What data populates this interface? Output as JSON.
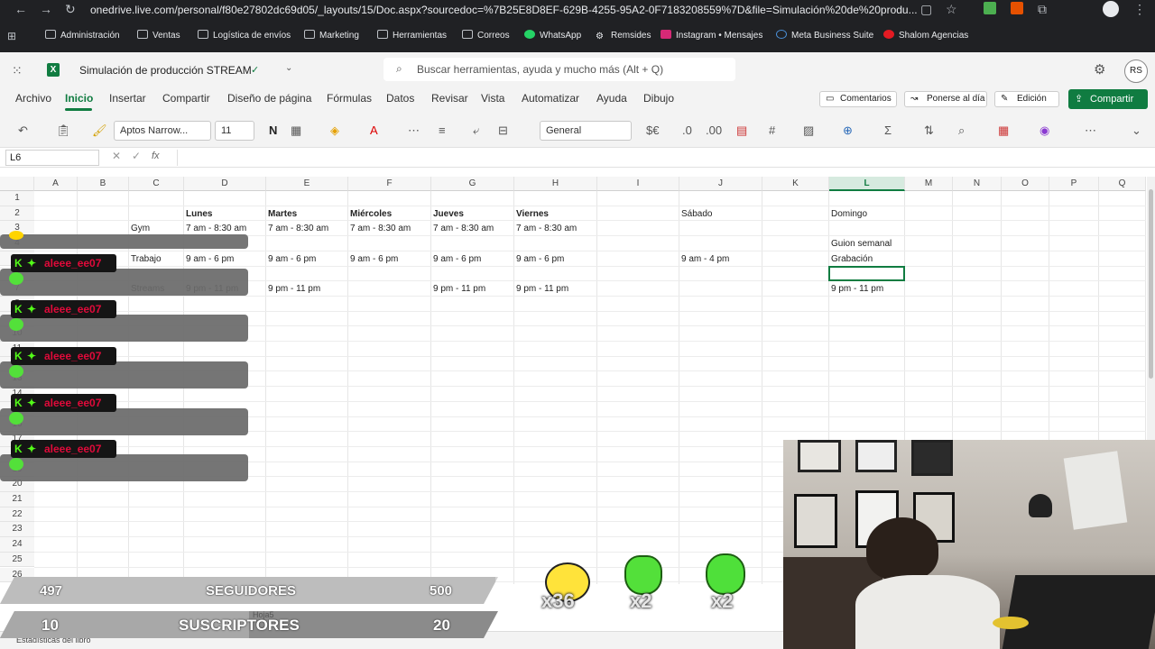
{
  "browser": {
    "url": "onedrive.live.com/personal/f80e27802dc69d05/_layouts/15/Doc.aspx?sourcedoc=%7B25E8D8EF-629B-4255-95A2-0F7183208559%7D&file=Simulación%20de%20produ...",
    "bookmarks": [
      "Administración",
      "Ventas",
      "Logística de envíos",
      "Marketing",
      "Herramientas",
      "Correos",
      "WhatsApp",
      "Remsides",
      "Instagram • Mensajes",
      "Meta Business Suite",
      "Shalom Agencias"
    ]
  },
  "app": {
    "title": "Simulación de producción STREAM",
    "search_placeholder": "Buscar herramientas, ayuda y mucho más (Alt + Q)",
    "avatar": "RS",
    "brand_color": "#107c41"
  },
  "menu": {
    "items": [
      "Archivo",
      "Inicio",
      "Insertar",
      "Compartir",
      "Diseño de página",
      "Fórmulas",
      "Datos",
      "Revisar",
      "Vista",
      "Automatizar",
      "Ayuda",
      "Dibujo"
    ],
    "active": "Inicio",
    "comments": "Comentarios",
    "catchup": "Ponerse al día",
    "editing": "Edición",
    "share": "Compartir"
  },
  "ribbon": {
    "font": "Aptos Narrow...",
    "size": "11",
    "bold": "N",
    "format": "General",
    "currency": "$€"
  },
  "formula": {
    "cell_ref": "L6",
    "fx": "fx"
  },
  "grid": {
    "columns": [
      "A",
      "B",
      "C",
      "D",
      "E",
      "F",
      "G",
      "H",
      "I",
      "J",
      "K",
      "L",
      "M",
      "N",
      "O",
      "P",
      "Q"
    ],
    "selected_col": "L",
    "rows": [
      "1",
      "2",
      "3",
      "4",
      "5",
      "6",
      "7",
      "8",
      "9",
      "10",
      "11",
      "12",
      "13",
      "14",
      "15",
      "16",
      "17",
      "18",
      "19",
      "20",
      "21",
      "22",
      "23",
      "24",
      "25",
      "26"
    ],
    "cells": {
      "D2": "Lunes",
      "E2": "Martes",
      "F2": "Miércoles",
      "G2": "Jueves",
      "H2": "Viernes",
      "J2": "Sábado",
      "L2": "Domingo",
      "C3": "Gym",
      "D3": "7 am - 8:30 am",
      "E3": "7 am - 8:30 am",
      "F3": "7 am - 8:30 am",
      "G3": "7 am - 8:30 am",
      "H3": "7 am - 8:30 am",
      "L4": "Guion semanal",
      "C5": "Trabajo",
      "D5": "9 am - 6 pm",
      "E5": "9 am - 6 pm",
      "F5": "9 am - 6 pm",
      "G5": "9 am - 6 pm",
      "H5": "9 am - 6 pm",
      "J5": "9 am - 4 pm",
      "L5": "Grabación",
      "C7": "Streams",
      "D7": "9 pm - 11 pm",
      "E7": "9 pm - 11 pm",
      "G7": "9 pm - 11 pm",
      "H7": "9 pm - 11 pm",
      "L7": "9 pm - 11 pm"
    }
  },
  "status": {
    "sheet": "Hoja5",
    "stats": "Estadísticas del libro"
  },
  "overlay": {
    "chat_user": "aleee_ee07",
    "followers": {
      "current": "497",
      "label": "SEGUIDORES",
      "goal": "500",
      "progress": 0.994
    },
    "subscribers": {
      "current": "10",
      "label": "SUSCRIPTORES",
      "goal": "20",
      "progress": 0.5
    },
    "counters": [
      "x36",
      "x2",
      "x2"
    ],
    "chip_colors": {
      "bg": "#151515",
      "name": "#e00a3a",
      "kick": "#53fc18"
    }
  }
}
